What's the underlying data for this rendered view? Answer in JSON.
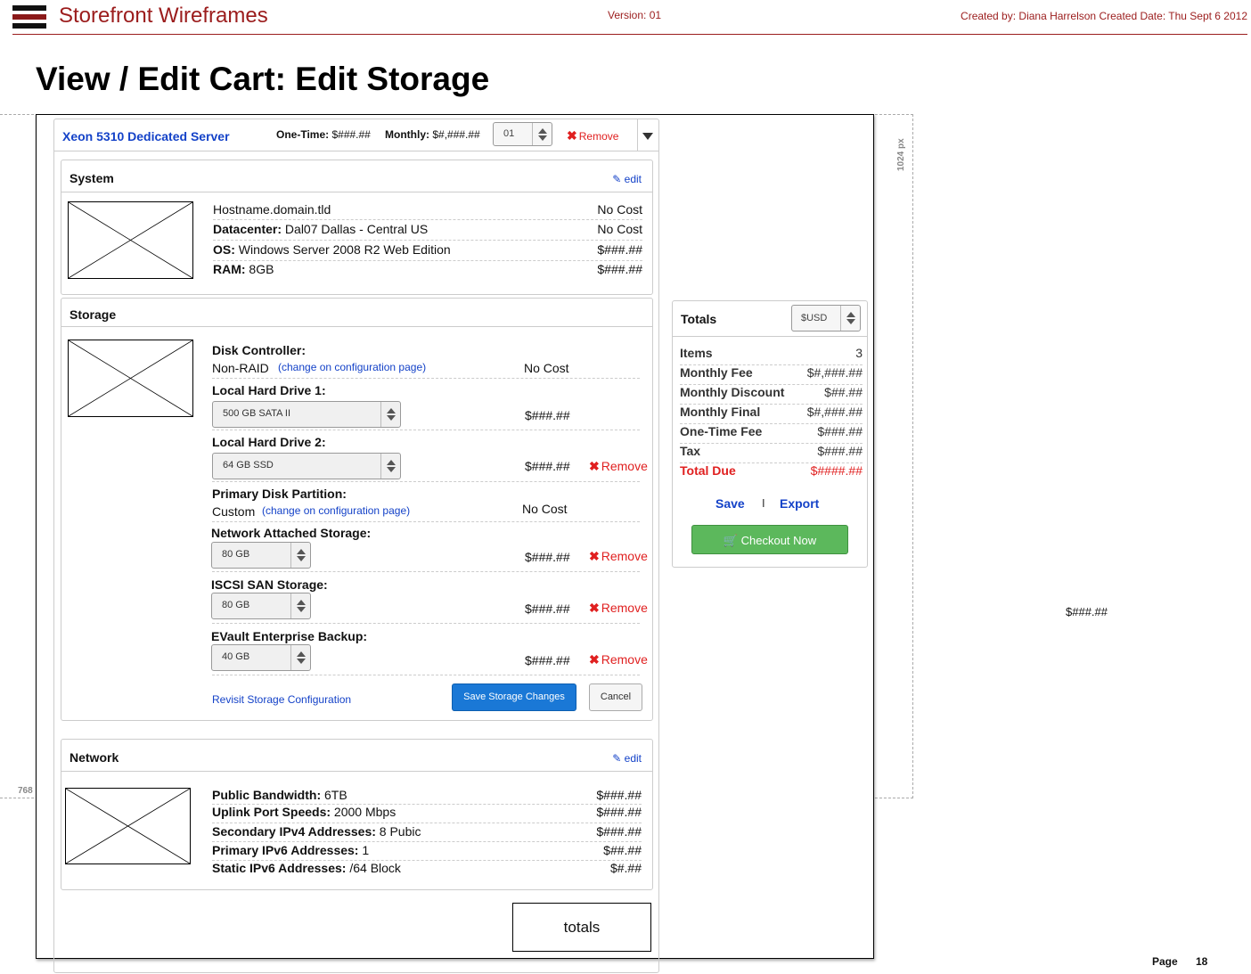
{
  "header": {
    "app_title": "Storefront Wireframes",
    "version": "Version: 01",
    "created": "Created by: Diana Harrelson  Created Date: Thu Sept 6 2012",
    "page_title": "View / Edit Cart: Edit Storage"
  },
  "guides": {
    "width_label": "1024 px",
    "height_label": "768"
  },
  "product": {
    "name": "Xeon 5310 Dedicated Server",
    "onetime_label": "One-Time:",
    "onetime_value": "$###.##",
    "monthly_label": "Monthly:",
    "monthly_value": "$#,###.##",
    "quantity": "01",
    "remove_label": "Remove"
  },
  "system": {
    "title": "System",
    "edit_label": "edit",
    "rows": [
      {
        "label": "",
        "value": "Hostname.domain.tld",
        "price": "No Cost"
      },
      {
        "label": "Datacenter:",
        "value": " Dal07 Dallas - Central US",
        "price": "No Cost"
      },
      {
        "label": "OS:",
        "value": " Windows Server 2008 R2 Web Edition",
        "price": "$###.##"
      },
      {
        "label": "RAM:",
        "value": " 8GB",
        "price": "$###.##"
      }
    ]
  },
  "storage": {
    "title": "Storage",
    "disk_controller": {
      "label": "Disk Controller:",
      "value": "Non-RAID",
      "link": "(change on configuration page)",
      "price": "No Cost"
    },
    "drive1": {
      "label": "Local Hard Drive 1:",
      "selected": "500 GB SATA II",
      "price": "$###.##"
    },
    "drive2": {
      "label": "Local Hard Drive 2:",
      "selected": "64 GB SSD",
      "price": "$###.##",
      "remove": "Remove"
    },
    "partition": {
      "label": "Primary Disk Partition:",
      "value": "Custom",
      "link": "(change on configuration page)",
      "price": "No Cost"
    },
    "nas": {
      "label": "Network Attached Storage:",
      "selected": "80 GB",
      "price": "$###.##",
      "remove": "Remove"
    },
    "iscsi": {
      "label": "ISCSI SAN Storage:",
      "selected": "80 GB",
      "price": "$###.##",
      "remove": "Remove"
    },
    "evault": {
      "label": "EVault Enterprise Backup:",
      "selected": "40 GB",
      "price": "$###.##",
      "remove": "Remove"
    },
    "revisit_link": "Revisit Storage Configuration",
    "save_button": "Save Storage Changes",
    "cancel_button": "Cancel"
  },
  "network": {
    "title": "Network",
    "edit_label": "edit",
    "rows": [
      {
        "label": "Public Bandwidth:",
        "value": " 6TB",
        "price": "$###.##"
      },
      {
        "label": "Uplink Port Speeds:",
        "value": " 2000 Mbps",
        "price": "$###.##"
      },
      {
        "label": "Secondary IPv4 Addresses:",
        "value": " 8 Pubic",
        "price": "$###.##"
      },
      {
        "label": "Primary IPv6 Addresses:",
        "value": " 1",
        "price": "$##.##"
      },
      {
        "label": "Static IPv6 Addresses:",
        "value": " /64 Block",
        "price": "$#.##"
      }
    ]
  },
  "totals_placeholder": "totals",
  "totals": {
    "title": "Totals",
    "currency": "$USD",
    "rows": [
      {
        "label": "Items",
        "value": "3"
      },
      {
        "label": "Monthly Fee",
        "value": "$#,###.##"
      },
      {
        "label": "Monthly Discount",
        "value": "$##.##"
      },
      {
        "label": "Monthly Final",
        "value": "$#,###.##"
      },
      {
        "label": "One-Time Fee",
        "value": "$###.##"
      },
      {
        "label": "Tax",
        "value": "$###.##"
      },
      {
        "label": "Total Due",
        "value": "$####.##"
      }
    ],
    "save_link": "Save",
    "separator": "I",
    "export_link": "Export",
    "checkout_button": "Checkout Now"
  },
  "stray_price": "$###.##",
  "footer": {
    "page_label": "Page",
    "page_number": "18"
  },
  "colors": {
    "brand": "#9b1c1c",
    "link": "#1442c8",
    "remove": "#e02020",
    "checkout": "#5cb85c",
    "primary_button": "#1a78d6"
  }
}
